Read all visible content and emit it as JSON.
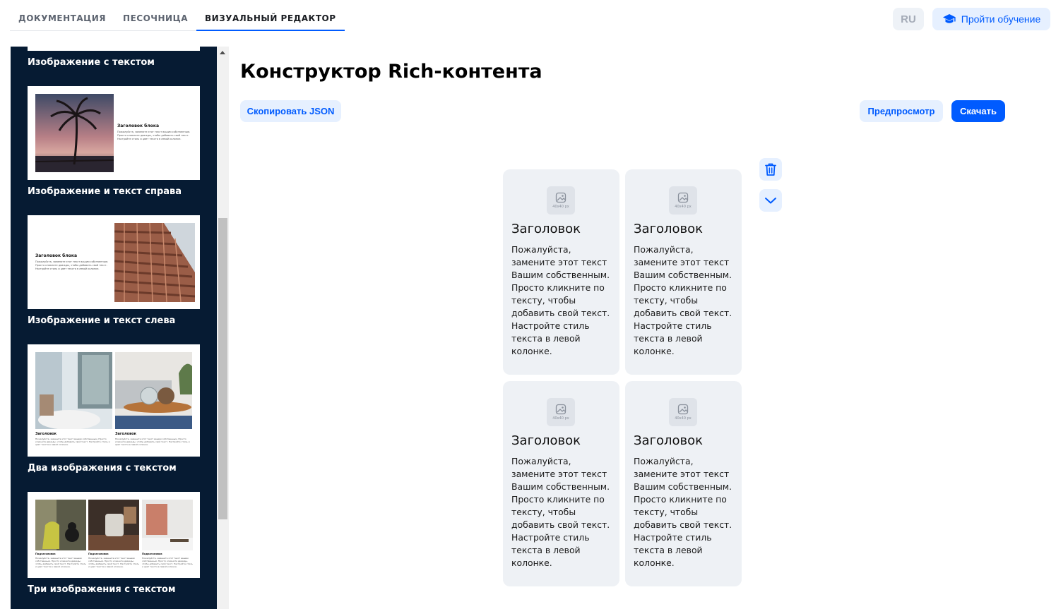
{
  "header": {
    "tabs": [
      {
        "label": "ДОКУМЕНТАЦИЯ",
        "active": false
      },
      {
        "label": "ПЕСОЧНИЦА",
        "active": false
      },
      {
        "label": "ВИЗУАЛЬНЫЙ РЕДАКТОР",
        "active": true
      }
    ],
    "lang_label": "RU",
    "learn_label": "Пройти обучение",
    "learn_icon": "graduation-cap-icon"
  },
  "sidebar": {
    "templates": [
      {
        "label": "Изображение с текстом"
      },
      {
        "label": "Изображение и текст справа",
        "block_title": "Заголовок блока",
        "block_text": "Пожалуйста, замените этот текст вашим собственным. Просто кликните дважды, чтобы добавить свой текст. Настройте стиль и цвет текста в левой колонке."
      },
      {
        "label": "Изображение и текст слева",
        "block_title": "Заголовок блока",
        "block_text": "Пожалуйста, замените этот текст вашим собственным. Просто кликните дважды, чтобы добавить свой текст. Настройте стиль и цвет текста в левой колонке."
      },
      {
        "label": "Два изображения с текстом",
        "item_title": "Заголовок",
        "item_text": "Пожалуйста, замените этот текст вашим собственным. Просто кликните дважды, чтобы добавить свой текст. Настройте стиль и цвет текста в левой колонке."
      },
      {
        "label": "Три изображения с текстом",
        "item_title": "Подзаголовок",
        "item_text": "Пожалуйста, замените этот текст вашим собственным. Просто кликните дважды, чтобы добавить свой текст. Настройте стиль и цвет текста в левой колонке."
      }
    ]
  },
  "main": {
    "title": "Конструктор Rich-контента",
    "copy_json_label": "Скопировать JSON",
    "preview_label": "Предпросмотр",
    "download_label": "Скачать",
    "cards": [
      {
        "icon_caption": "40x40 px",
        "heading": "Заголовок",
        "text": "Пожалуйста, замените этот текст Вашим собственным. Просто кликните по тексту, чтобы добавить свой текст. Настройте стиль текста в левой колонке."
      },
      {
        "icon_caption": "40x40 px",
        "heading": "Заголовок",
        "text": "Пожалуйста, замените этот текст Вашим собственным. Просто кликните по тексту, чтобы добавить свой текст. Настройте стиль текста в левой колонке."
      },
      {
        "icon_caption": "40x40 px",
        "heading": "Заголовок",
        "text": "Пожалуйста, замените этот текст Вашим собственным. Просто кликните по тексту, чтобы добавить свой текст. Настройте стиль текста в левой колонке."
      },
      {
        "icon_caption": "40x40 px",
        "heading": "Заголовок",
        "text": "Пожалуйста, замените этот текст Вашим собственным. Просто кликните по тексту, чтобы добавить свой текст. Настройте стиль текста в левой колонке."
      }
    ],
    "tools": [
      {
        "icon": "trash-icon"
      },
      {
        "icon": "chevron-down-icon"
      }
    ]
  },
  "colors": {
    "accent": "#005bff",
    "accent_light": "#e6f0ff",
    "sidebar_bg": "#061b33",
    "card_bg": "#eef1f5"
  }
}
